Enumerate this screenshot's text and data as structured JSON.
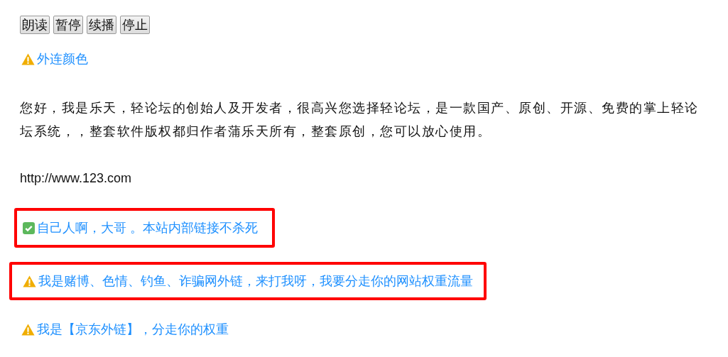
{
  "buttons": [
    "朗读",
    "暂停",
    "续播",
    "停止"
  ],
  "top_link": {
    "kind": "external",
    "text": "外连颜色"
  },
  "paragraph": "您好，我是乐天，轻论坛的创始人及开发者，很高兴您选择轻论坛，是一款国产、原创、开源、免费的掌上轻论坛系统，，整套软件版权都归作者蒲乐天所有，整套原创，您可以放心使用。",
  "url_text": "http://www.123.com",
  "links": [
    {
      "kind": "internal",
      "text": "自己人啊，大哥 。本站内部链接不杀死",
      "highlighted": true
    },
    {
      "kind": "external",
      "text": "我是赌博、色情、钓鱼、诈骗网外链，来打我呀，我要分走你的网站权重流量",
      "highlighted": true
    },
    {
      "kind": "external",
      "text": "我是【京东外链】，分走你的权重",
      "highlighted": false
    }
  ]
}
